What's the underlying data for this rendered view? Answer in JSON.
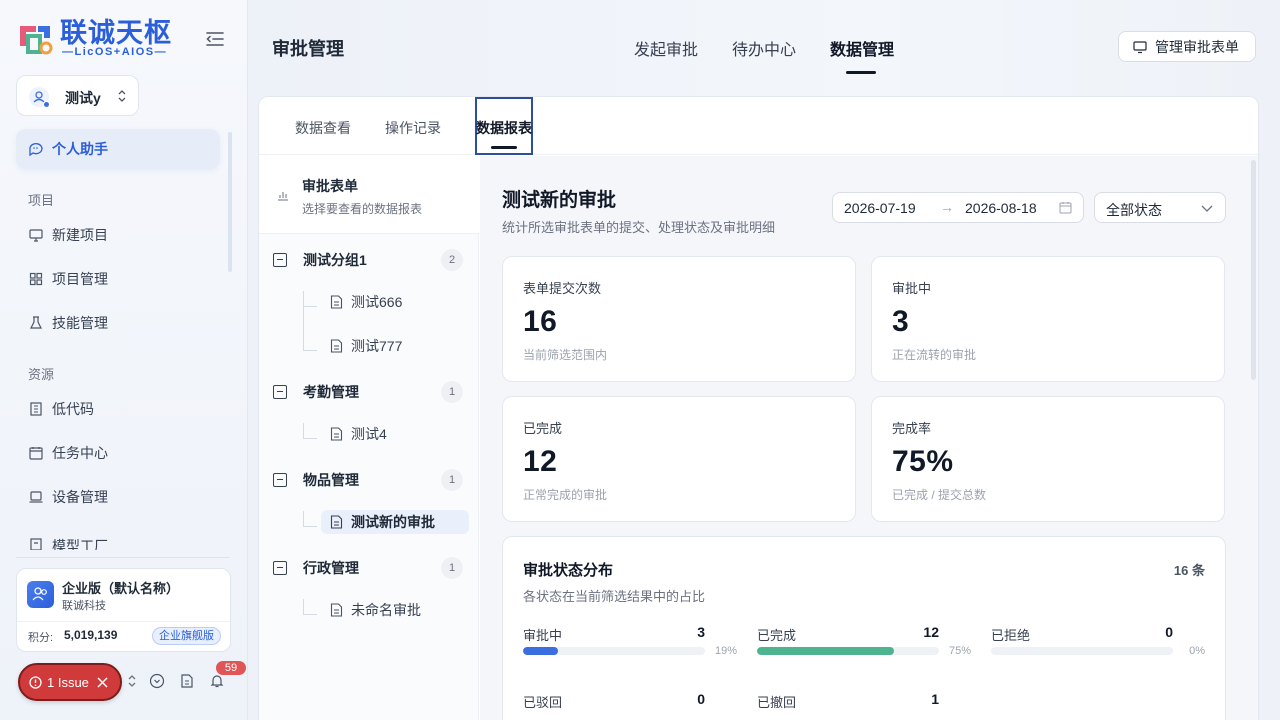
{
  "brand": {
    "name": "联诚天枢",
    "sub": "—LicOS+AIOS—"
  },
  "user": {
    "name": "测试y"
  },
  "sidebar": {
    "items": [
      {
        "label": "个人助手",
        "icon": "chat-icon"
      },
      {
        "label": "新建项目",
        "icon": "monitor-icon"
      },
      {
        "label": "项目管理",
        "icon": "grid-icon"
      },
      {
        "label": "技能管理",
        "icon": "flask-icon"
      },
      {
        "label": "低代码",
        "icon": "building-icon"
      },
      {
        "label": "任务中心",
        "icon": "calendar-icon"
      },
      {
        "label": "设备管理",
        "icon": "laptop-icon"
      },
      {
        "label": "模型工厂",
        "icon": "box-icon"
      }
    ],
    "sections": {
      "project": "项目",
      "resource": "资源"
    }
  },
  "org": {
    "name": "企业版（默认名称）",
    "company": "联诚科技",
    "points_label": "积分:",
    "points": "5,019,139",
    "badge": "企业旗舰版"
  },
  "issue": {
    "label": "1 Issue"
  },
  "notifications": {
    "count": "59"
  },
  "header": {
    "title": "审批管理",
    "tabs": [
      "发起审批",
      "待办中心",
      "数据管理"
    ],
    "active_tab": "数据管理",
    "manage_button": "管理审批表单"
  },
  "subtabs": [
    "数据查看",
    "操作记录",
    "数据报表"
  ],
  "tree": {
    "title": "审批表单",
    "subtitle": "选择要查看的数据报表",
    "groups": [
      {
        "name": "测试分组1",
        "count": "2",
        "items": [
          "测试666",
          "测试777"
        ]
      },
      {
        "name": "考勤管理",
        "count": "1",
        "items": [
          "测试4"
        ]
      },
      {
        "name": "物品管理",
        "count": "1",
        "items": [
          "测试新的审批"
        ]
      },
      {
        "name": "行政管理",
        "count": "1",
        "items": [
          "未命名审批"
        ]
      }
    ],
    "selected": "测试新的审批"
  },
  "report": {
    "title": "测试新的审批",
    "subtitle": "统计所选审批表单的提交、处理状态及审批明细",
    "date_start": "2026-07-19",
    "date_arrow": "→",
    "date_end": "2026-08-18",
    "status_filter": "全部状态",
    "stats": [
      {
        "label": "表单提交次数",
        "value": "16",
        "note": "当前筛选范围内"
      },
      {
        "label": "审批中",
        "value": "3",
        "note": "正在流转的审批"
      },
      {
        "label": "已完成",
        "value": "12",
        "note": "正常完成的审批"
      },
      {
        "label": "完成率",
        "value": "75%",
        "note": "已完成 / 提交总数"
      }
    ],
    "distribution": {
      "title": "审批状态分布",
      "total": "16 条",
      "subtitle": "各状态在当前筛选结果中的占比",
      "items": [
        {
          "name": "审批中",
          "count": "3",
          "pct": "19%",
          "fraction": 0.19,
          "color": "#3b6fe0"
        },
        {
          "name": "已完成",
          "count": "12",
          "pct": "75%",
          "fraction": 0.75,
          "color": "#4fb38f"
        },
        {
          "name": "已拒绝",
          "count": "0",
          "pct": "0%",
          "fraction": 0,
          "color": "#e05555"
        },
        {
          "name": "已驳回",
          "count": "0",
          "pct": "",
          "fraction": 0,
          "color": "#f0a040"
        },
        {
          "name": "已撤回",
          "count": "1",
          "pct": "",
          "fraction": 0,
          "color": "#9ca3af"
        }
      ]
    }
  }
}
